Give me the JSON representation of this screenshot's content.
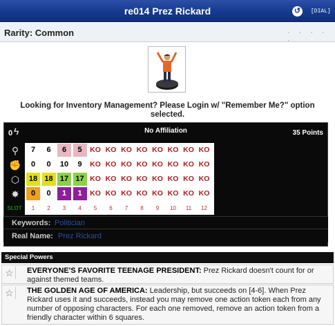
{
  "header": {
    "title": "re014 Prez Rickard",
    "undo_icon": "undo-arrow-icon",
    "dial_link": "[DIAL]"
  },
  "rarity": {
    "text": "Rarity: Common",
    "dots": "· · · · ·"
  },
  "figure": {
    "description_icon": "figure-image"
  },
  "inventory_notice": "Looking for Inventory Management? Please Login w/ \"Remember Me?\" option selected.",
  "dial": {
    "range": "0",
    "team": "No Affiliation",
    "points": "35 Points",
    "stat_icons": [
      "speed-icon",
      "attack-icon",
      "defense-icon",
      "damage-icon"
    ],
    "rows": [
      {
        "stat": "speed",
        "values": [
          "7",
          "6",
          "6",
          "5",
          "KO",
          "KO",
          "KO",
          "KO",
          "KO",
          "KO",
          "KO",
          "KO"
        ],
        "bg": [
          "",
          "",
          "#e8b7c2",
          "#e8b7c2",
          "",
          "",
          "",
          "",
          "",
          "",
          "",
          ""
        ]
      },
      {
        "stat": "attack",
        "values": [
          "0",
          "0",
          "10",
          "9",
          "KO",
          "KO",
          "KO",
          "KO",
          "KO",
          "KO",
          "KO",
          "KO"
        ],
        "bg": [
          "",
          "",
          "",
          "",
          "",
          "",
          "",
          "",
          "",
          "",
          "",
          ""
        ]
      },
      {
        "stat": "defense",
        "values": [
          "18",
          "18",
          "17",
          "17",
          "KO",
          "KO",
          "KO",
          "KO",
          "KO",
          "KO",
          "KO",
          "KO"
        ],
        "bg": [
          "#e0e01a",
          "#e0e01a",
          "#8cd04a",
          "#8cd04a",
          "",
          "",
          "",
          "",
          "",
          "",
          "",
          ""
        ]
      },
      {
        "stat": "damage",
        "values": [
          "0",
          "0",
          "1",
          "1",
          "KO",
          "KO",
          "KO",
          "KO",
          "KO",
          "KO",
          "KO",
          "KO"
        ],
        "bg": [
          "#f0a020",
          "",
          "#8e1f9a",
          "#8e1f9a",
          "",
          "",
          "",
          "",
          "",
          "",
          "",
          ""
        ]
      }
    ],
    "slot_label": "SLOT",
    "slots": [
      "1",
      "2",
      "3",
      "4",
      "5",
      "6",
      "7",
      "8",
      "9",
      "10",
      "11",
      "12"
    ]
  },
  "keywords": {
    "label": "Keywords:",
    "value": "Politician"
  },
  "real_name": {
    "label": "Real Name:",
    "value": "Prez Rickard"
  },
  "special_powers": {
    "heading": "Special Powers",
    "items": [
      {
        "name": "EVERYONE'S FAVORITE TEENAGE PRESIDENT:",
        "text": " Prez Rickard doesn't count for or against themed teams."
      },
      {
        "name": "THE GOLDEN AGE OF AMERICA:",
        "text": " Leadership, but succeeds on [4-6]. When Prez Rickard uses it and succeeds, instead you may remove one action token each from any number of opposing characters. For each one removed, remove an action token from a friendly character within 6 squares."
      }
    ]
  }
}
